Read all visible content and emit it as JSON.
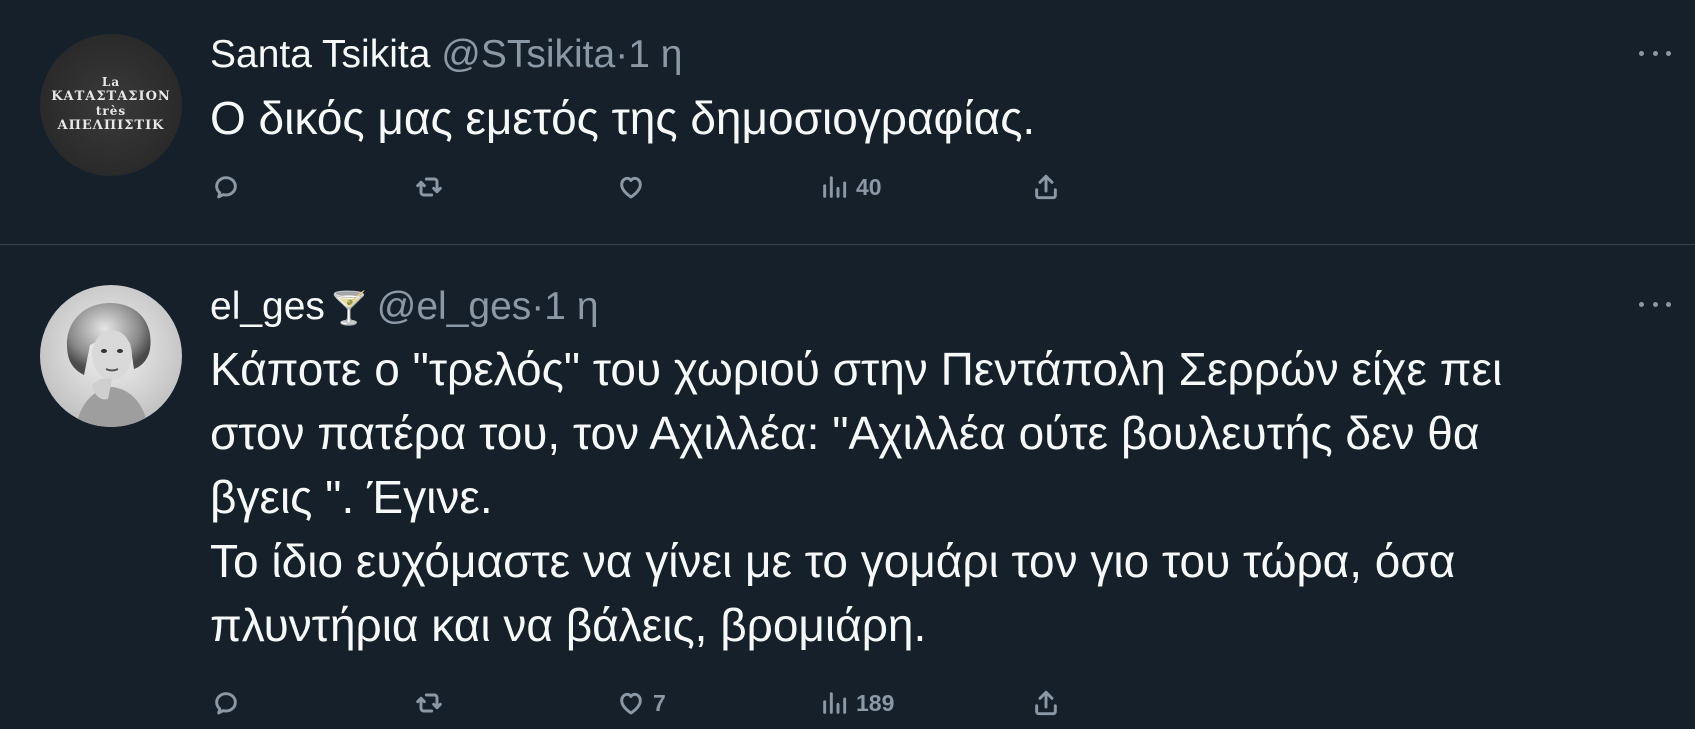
{
  "tweets": [
    {
      "display_name": "Santa Tsikita",
      "emoji": "",
      "handle": "@STsikita",
      "separator": "·",
      "time": "1 η",
      "avatar": {
        "type": "sign",
        "lines": [
          "La",
          "ΚΑΤΑΣΤΑΣΙΟΝ",
          "très",
          "ΑΠΕΛΠΙΣΤΙΚ"
        ]
      },
      "text_lines": [
        "Ο δικός μας εμετός της δημοσιογραφίας."
      ],
      "actions": {
        "reply_count": "",
        "retweet_count": "",
        "like_count": "",
        "views_count": "40"
      }
    },
    {
      "display_name": "el_ges",
      "emoji": "🍸",
      "handle": "@el_ges",
      "separator": "·",
      "time": "1 η",
      "avatar": {
        "type": "photo"
      },
      "text_lines": [
        "Κάποτε ο \"τρελός\" του χωριού στην Πεντάπολη Σερρών είχε πει",
        "στον πατέρα του, τον Αχιλλέα: \"Αχιλλέα ούτε βουλευτής δεν θα",
        "βγεις \". Έγινε.",
        "Το ίδιο ευχόμαστε να γίνει με το γομάρι τον γιο του τώρα, όσα",
        "πλυντήρια και να βάλεις, βρομιάρη."
      ],
      "actions": {
        "reply_count": "",
        "retweet_count": "",
        "like_count": "7",
        "views_count": "189"
      }
    }
  ],
  "icons": {
    "reply": "reply-icon",
    "retweet": "retweet-icon",
    "like": "heart-icon",
    "views": "views-icon",
    "share": "share-icon",
    "more": "more-icon"
  },
  "colors": {
    "background": "#15202b",
    "text_primary": "#f7f9f9",
    "text_secondary": "#8b98a5",
    "divider": "#38444d"
  }
}
